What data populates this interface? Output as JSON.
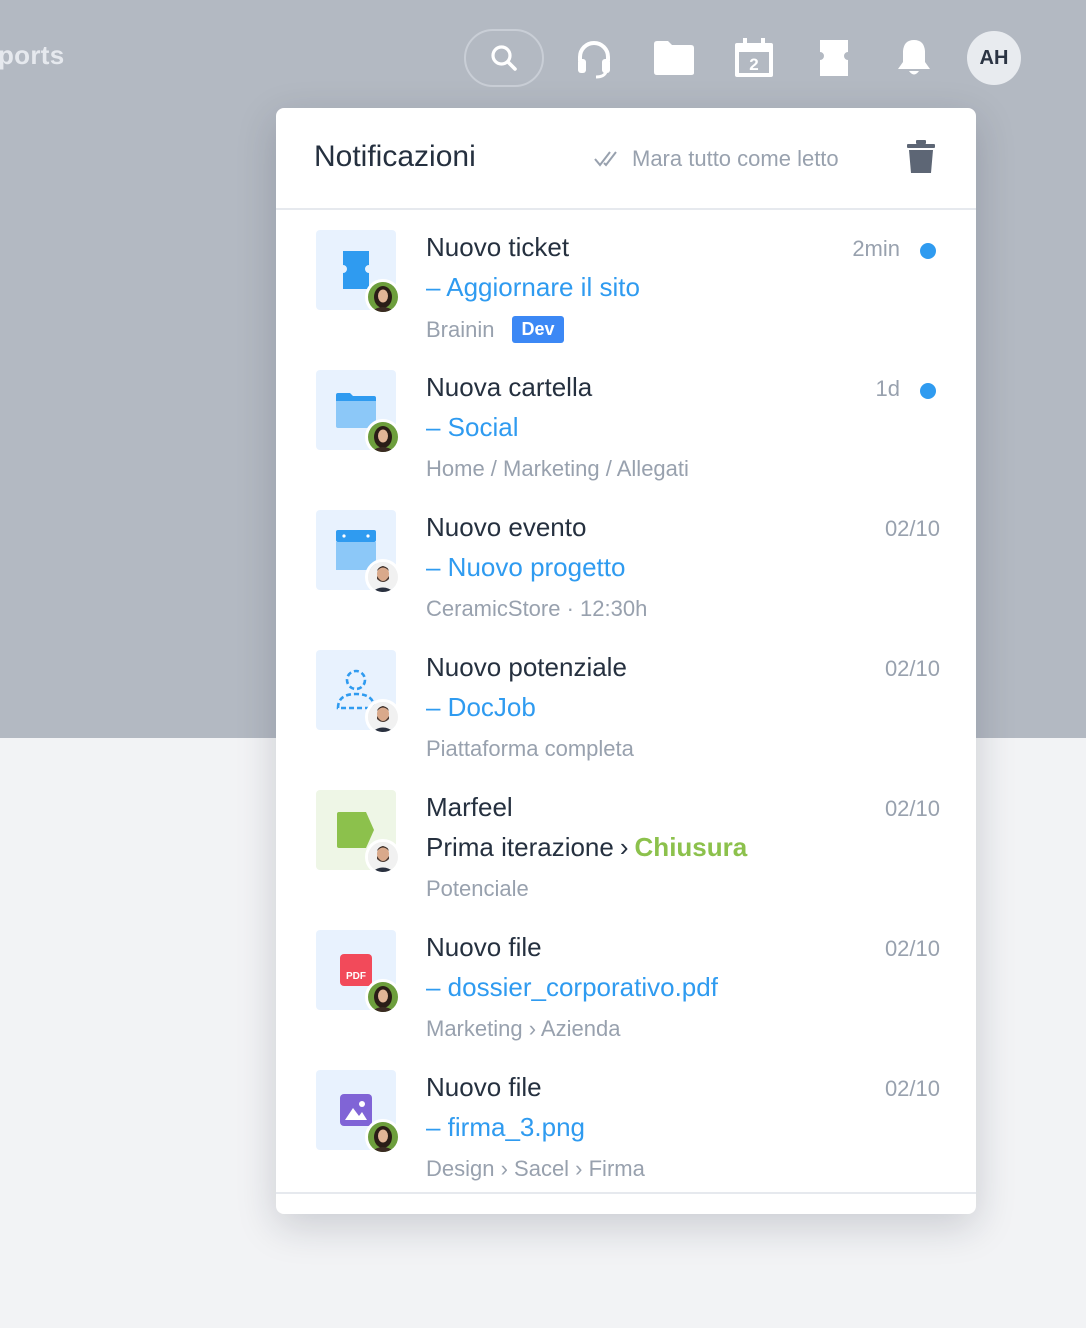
{
  "topbar": {
    "nav_partial": "ports",
    "calendar_day": "2",
    "user_initials": "AH"
  },
  "panel": {
    "title": "Notificazioni",
    "mark_all_read": "Mara tutto come letto"
  },
  "notifications": [
    {
      "icon": "ticket-icon",
      "avatar": "woman",
      "title": "Nuovo ticket",
      "subject": "– Aggiornare il sito",
      "meta": "Brainin",
      "badge": "Dev",
      "time": "2min",
      "unread": true
    },
    {
      "icon": "folder-icon",
      "avatar": "woman",
      "title": "Nuova cartella",
      "subject": "– Social",
      "meta": "Home / Marketing / Allegati",
      "time": "1d",
      "unread": true
    },
    {
      "icon": "calendar-icon",
      "avatar": "man",
      "title": "Nuovo evento",
      "subject": "– Nuovo progetto",
      "meta": "CeramicStore · 12:30h",
      "time": "02/10",
      "unread": false
    },
    {
      "icon": "lead-icon",
      "avatar": "man",
      "title": "Nuovo potenziale",
      "subject": "– DocJob",
      "meta": "Piattaforma completa",
      "time": "02/10",
      "unread": false
    },
    {
      "icon": "tag-icon",
      "avatar": "man",
      "title": "Marfeel",
      "stage_from": "Prima iterazione",
      "stage_sep": "›",
      "stage_to": "Chiusura",
      "meta": "Potenciale",
      "time": "02/10",
      "unread": false
    },
    {
      "icon": "pdf-icon",
      "icon_text": "PDF",
      "avatar": "woman",
      "title": "Nuovo file",
      "subject": "– dossier_corporativo.pdf",
      "meta": "Marketing › Azienda",
      "time": "02/10",
      "unread": false
    },
    {
      "icon": "image-icon",
      "avatar": "woman",
      "title": "Nuovo file",
      "subject": "– firma_3.png",
      "meta": "Design › Sacel › Firma",
      "time": "02/10",
      "unread": false
    }
  ],
  "colors": {
    "accent": "#2f9bf0",
    "badge": "#3c88f5",
    "stage_green": "#8cc14c",
    "pdf_red": "#f24a5a",
    "image_purple": "#8064d6"
  }
}
